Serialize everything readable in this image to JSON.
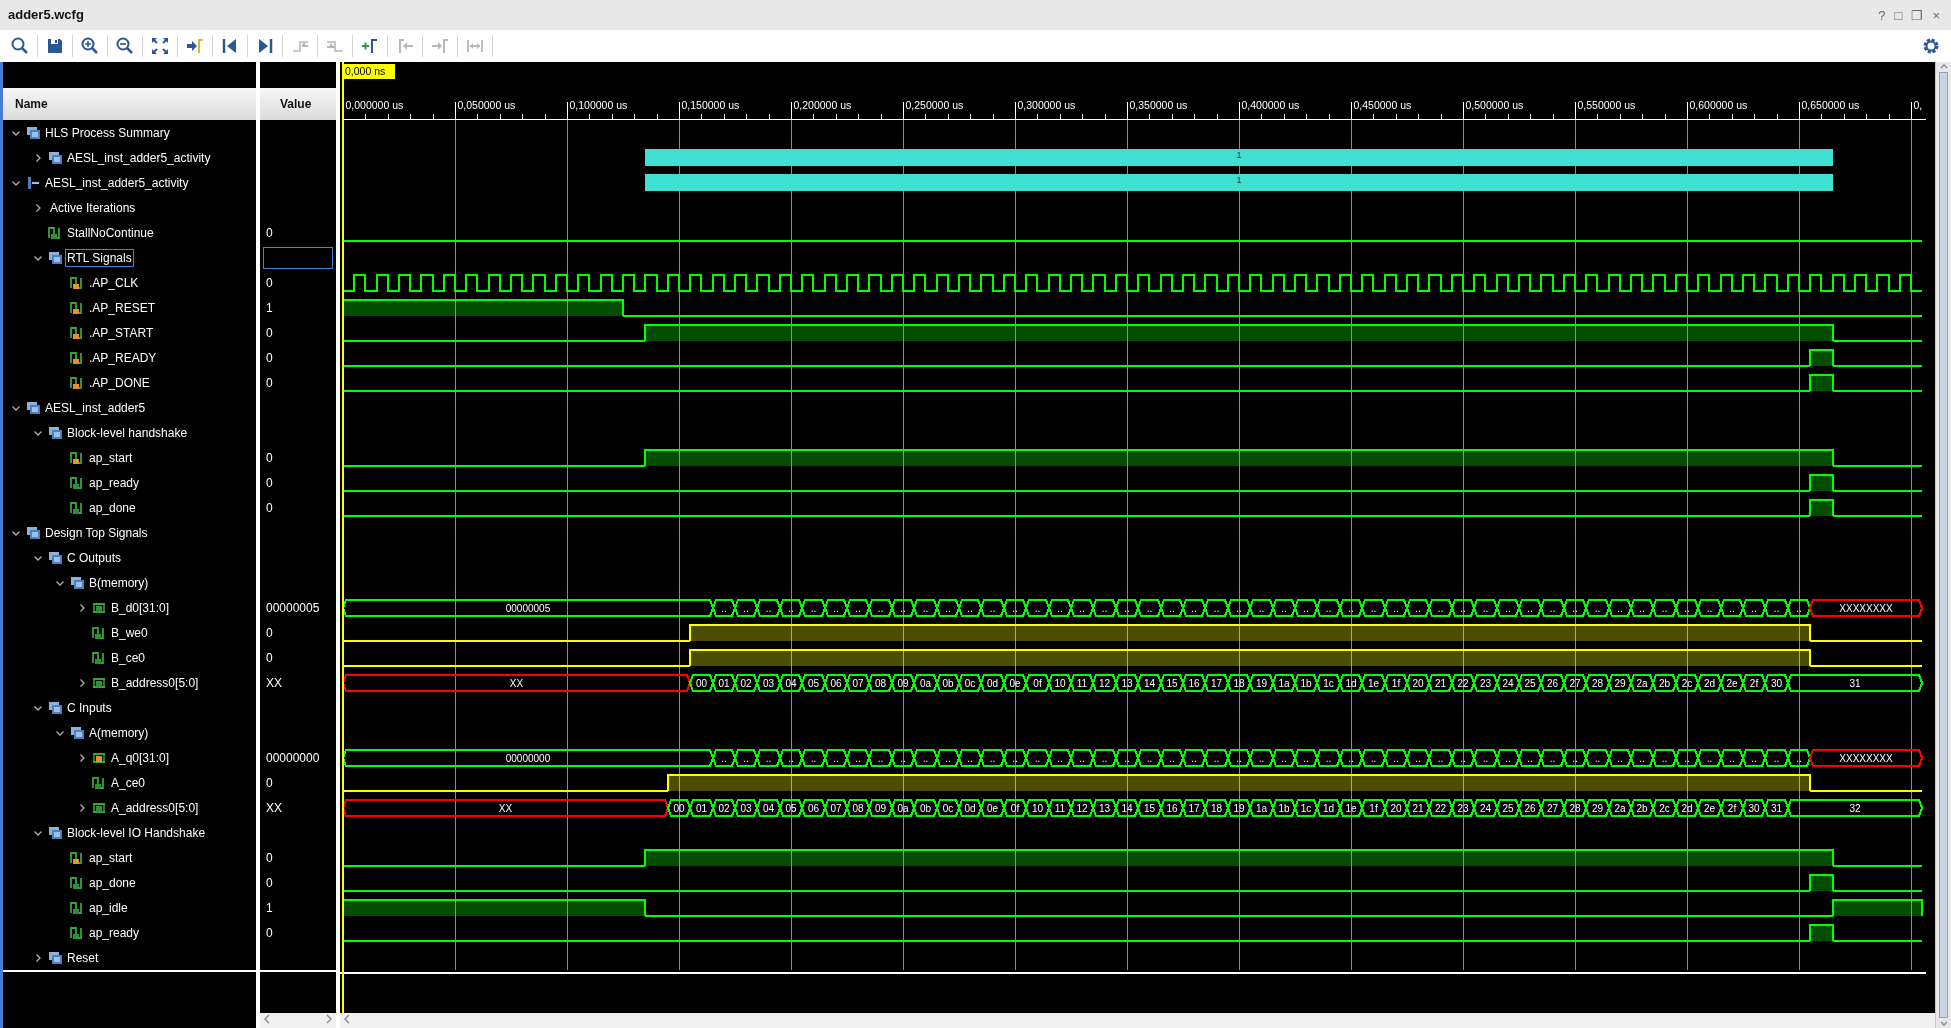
{
  "window": {
    "title": "adder5.wcfg",
    "controls": [
      "?",
      "□",
      "❐",
      "×"
    ]
  },
  "toolbar": [
    {
      "kind": "search",
      "disabled": false
    },
    {
      "kind": "save",
      "disabled": false
    },
    {
      "kind": "zoom-in",
      "disabled": false
    },
    {
      "kind": "zoom-out",
      "disabled": false
    },
    {
      "kind": "fit",
      "disabled": false
    },
    {
      "kind": "go-to-cursor",
      "disabled": false
    },
    {
      "kind": "go-first",
      "disabled": false
    },
    {
      "kind": "go-last",
      "disabled": false
    },
    {
      "kind": "prev-transition",
      "disabled": true
    },
    {
      "kind": "next-transition",
      "disabled": true
    },
    {
      "kind": "add-marker",
      "disabled": false
    },
    {
      "kind": "prev-marker",
      "disabled": true
    },
    {
      "kind": "next-marker",
      "disabled": true
    },
    {
      "kind": "swap",
      "disabled": true
    },
    {
      "kind": "settings",
      "disabled": false
    }
  ],
  "columns": [
    "Name",
    "Value"
  ],
  "waveform": {
    "cursor": "0,000 ns",
    "ruler": [
      "0,000000 us",
      "0,050000 us",
      "0,100000 us",
      "0,150000 us",
      "0,200000 us",
      "0,250000 us",
      "0,300000 us",
      "0,350000 us",
      "0,400000 us",
      "0,450000 us",
      "0,500000 us",
      "0,550000 us",
      "0,600000 us",
      "0,650000 us",
      "0,"
    ]
  },
  "tree": [
    {
      "label": "HLS Process Summary",
      "kind": "group",
      "expanded": true,
      "selected": false,
      "children": [
        {
          "label": "AESL_inst_adder5_activity",
          "kind": "group",
          "expanded": false,
          "selected": false,
          "wave": {
            "kind": "bar",
            "color": "#40e0d0",
            "label": "1"
          }
        }
      ]
    },
    {
      "label": "AESL_inst_adder5_activity",
      "kind": "activity",
      "expanded": true,
      "selected": false,
      "wave": {
        "kind": "bar",
        "color": "#40e0d0",
        "label": "1"
      },
      "children": [
        {
          "label": "Active Iterations",
          "expanded": false,
          "selected": false
        },
        {
          "label": "StallNoContinue",
          "kind": "bit-out",
          "value": "0",
          "selected": false,
          "wave": {
            "kind": "bit",
            "color": "#00ff00",
            "phases": [
              {
                "high": false
              }
            ]
          }
        },
        {
          "label": "RTL Signals",
          "kind": "group",
          "expanded": true,
          "selected": true,
          "children": [
            {
              "label": ".AP_CLK",
              "kind": "bit-in",
              "value": "0",
              "selected": false,
              "wave": {
                "kind": "clock",
                "color": "#00ff00"
              }
            },
            {
              "label": ".AP_RESET",
              "kind": "bit-in",
              "value": "1",
              "selected": false,
              "wave": {
                "kind": "bit",
                "color": "#00ff00",
                "phases": [
                  {
                    "high": true
                  },
                  {
                    "high": false
                  }
                ]
              }
            },
            {
              "label": ".AP_START",
              "kind": "bit-in",
              "value": "0",
              "selected": false,
              "wave": {
                "kind": "bit",
                "color": "#00ff00",
                "phases": [
                  {
                    "high": false
                  },
                  {
                    "high": true
                  },
                  {
                    "high": false
                  }
                ]
              }
            },
            {
              "label": ".AP_READY",
              "kind": "bit-in",
              "value": "0",
              "selected": false,
              "wave": {
                "kind": "bit",
                "color": "#00ff00",
                "phases": [
                  {
                    "high": false
                  },
                  {
                    "high": true
                  },
                  {
                    "high": false
                  }
                ]
              }
            },
            {
              "label": ".AP_DONE",
              "kind": "bit-in",
              "value": "0",
              "selected": false,
              "wave": {
                "kind": "bit",
                "color": "#00ff00",
                "phases": [
                  {
                    "high": false
                  },
                  {
                    "high": true
                  },
                  {
                    "high": false
                  }
                ]
              }
            }
          ]
        }
      ]
    },
    {
      "label": "AESL_inst_adder5",
      "kind": "group",
      "expanded": true,
      "selected": false,
      "children": [
        {
          "label": "Block-level handshake",
          "kind": "group",
          "expanded": true,
          "selected": false,
          "children": [
            {
              "label": "ap_start",
              "kind": "bit-in",
              "value": "0",
              "selected": false,
              "wave": {
                "kind": "bit",
                "color": "#00ff00",
                "phases": [
                  {
                    "high": false
                  },
                  {
                    "high": true
                  },
                  {
                    "high": false
                  }
                ]
              }
            },
            {
              "label": "ap_ready",
              "kind": "bit-out",
              "value": "0",
              "selected": false,
              "wave": {
                "kind": "bit",
                "color": "#00ff00",
                "phases": [
                  {
                    "high": false
                  },
                  {
                    "high": true
                  },
                  {
                    "high": false
                  }
                ]
              }
            },
            {
              "label": "ap_done",
              "kind": "bit-out",
              "value": "0",
              "selected": false,
              "wave": {
                "kind": "bit",
                "color": "#00ff00",
                "phases": [
                  {
                    "high": false
                  },
                  {
                    "high": true
                  },
                  {
                    "high": false
                  }
                ]
              }
            }
          ]
        }
      ]
    },
    {
      "label": "Design Top Signals",
      "kind": "group",
      "expanded": true,
      "selected": false,
      "children": [
        {
          "label": "C Outputs",
          "kind": "group",
          "expanded": true,
          "selected": false,
          "children": [
            {
              "label": "B(memory)",
              "kind": "group",
              "expanded": true,
              "selected": false,
              "children": [
                {
                  "label": "B_d0[31:0]",
                  "kind": "bus-out",
                  "expanded": false,
                  "value": "00000005",
                  "selected": false,
                  "wave": {
                    "kind": "bus",
                    "color": "#00ff00",
                    "segments": [
                      {
                        "unknown": false,
                        "labels": [
                          "00000005"
                        ]
                      },
                      {
                        "unknown": false,
                        "labels": [
                          "..",
                          "..",
                          "..",
                          "..",
                          "..",
                          "..",
                          "..",
                          "..",
                          "..",
                          "..",
                          "..",
                          "..",
                          "..",
                          "..",
                          "..",
                          "..",
                          "..",
                          "..",
                          "..",
                          "..",
                          "..",
                          "..",
                          "..",
                          "..",
                          "..",
                          "..",
                          "..",
                          "..",
                          "..",
                          "..",
                          "..",
                          "..",
                          "..",
                          "..",
                          "..",
                          "..",
                          "..",
                          "..",
                          "..",
                          "..",
                          "..",
                          "..",
                          "..",
                          "..",
                          "..",
                          "..",
                          "..",
                          "..",
                          ".."
                        ]
                      },
                      {
                        "unknown": true,
                        "labels": [
                          "XXXXXXXX"
                        ]
                      }
                    ]
                  }
                },
                {
                  "label": "B_we0",
                  "kind": "bit-out",
                  "value": "0",
                  "selected": false,
                  "wave": {
                    "kind": "bit",
                    "color": "#ffff00",
                    "phases": [
                      {
                        "high": false
                      },
                      {
                        "high": true
                      },
                      {
                        "high": false
                      }
                    ]
                  }
                },
                {
                  "label": "B_ce0",
                  "kind": "bit-out",
                  "value": "0",
                  "selected": false,
                  "wave": {
                    "kind": "bit",
                    "color": "#ffff00",
                    "phases": [
                      {
                        "high": false
                      },
                      {
                        "high": true
                      },
                      {
                        "high": false
                      }
                    ]
                  }
                },
                {
                  "label": "B_address0[5:0]",
                  "kind": "bus-out",
                  "expanded": false,
                  "value": "XX",
                  "selected": false,
                  "wave": {
                    "kind": "bus",
                    "color": "#00ff00",
                    "segments": [
                      {
                        "unknown": true,
                        "labels": [
                          "XX"
                        ]
                      },
                      {
                        "unknown": false,
                        "labels": [
                          "00",
                          "01",
                          "02",
                          "03",
                          "04",
                          "05",
                          "06",
                          "07",
                          "08",
                          "09",
                          "0a",
                          "0b",
                          "0c",
                          "0d",
                          "0e",
                          "0f",
                          "10",
                          "11",
                          "12",
                          "13",
                          "14",
                          "15",
                          "16",
                          "17",
                          "18",
                          "19",
                          "1a",
                          "1b",
                          "1c",
                          "1d",
                          "1e",
                          "1f",
                          "20",
                          "21",
                          "22",
                          "23",
                          "24",
                          "25",
                          "26",
                          "27",
                          "28",
                          "29",
                          "2a",
                          "2b",
                          "2c",
                          "2d",
                          "2e",
                          "2f",
                          "30"
                        ]
                      },
                      {
                        "unknown": false,
                        "labels": [
                          "31"
                        ]
                      }
                    ]
                  }
                }
              ]
            }
          ]
        },
        {
          "label": "C Inputs",
          "kind": "group",
          "expanded": true,
          "selected": false,
          "children": [
            {
              "label": "A(memory)",
              "kind": "group",
              "expanded": true,
              "selected": false,
              "children": [
                {
                  "label": "A_q0[31:0]",
                  "kind": "bus-in",
                  "expanded": false,
                  "value": "00000000",
                  "selected": false,
                  "wave": {
                    "kind": "bus",
                    "color": "#00ff00",
                    "segments": [
                      {
                        "unknown": false,
                        "labels": [
                          "00000000"
                        ]
                      },
                      {
                        "unknown": false,
                        "labels": [
                          "..",
                          "..",
                          "..",
                          "..",
                          "..",
                          "..",
                          "..",
                          "..",
                          "..",
                          "..",
                          "..",
                          "..",
                          "..",
                          "..",
                          "..",
                          "..",
                          "..",
                          "..",
                          "..",
                          "..",
                          "..",
                          "..",
                          "..",
                          "..",
                          "..",
                          "..",
                          "..",
                          "..",
                          "..",
                          "..",
                          "..",
                          "..",
                          "..",
                          "..",
                          "..",
                          "..",
                          "..",
                          "..",
                          "..",
                          "..",
                          "..",
                          "..",
                          "..",
                          "..",
                          "..",
                          "..",
                          "..",
                          "..",
                          ".."
                        ]
                      },
                      {
                        "unknown": true,
                        "labels": [
                          "XXXXXXXX"
                        ]
                      }
                    ]
                  }
                },
                {
                  "label": "A_ce0",
                  "kind": "bit-out",
                  "value": "0",
                  "selected": false,
                  "wave": {
                    "kind": "bit",
                    "color": "#ffff00",
                    "phases": [
                      {
                        "high": false
                      },
                      {
                        "high": true
                      },
                      {
                        "high": false
                      }
                    ]
                  }
                },
                {
                  "label": "A_address0[5:0]",
                  "kind": "bus-out",
                  "expanded": false,
                  "value": "XX",
                  "selected": false,
                  "wave": {
                    "kind": "bus",
                    "color": "#00ff00",
                    "segments": [
                      {
                        "unknown": true,
                        "labels": [
                          "XX"
                        ]
                      },
                      {
                        "unknown": false,
                        "labels": [
                          "00",
                          "01",
                          "02",
                          "03",
                          "04",
                          "05",
                          "06",
                          "07",
                          "08",
                          "09",
                          "0a",
                          "0b",
                          "0c",
                          "0d",
                          "0e",
                          "0f",
                          "10",
                          "11",
                          "12",
                          "13",
                          "14",
                          "15",
                          "16",
                          "17",
                          "18",
                          "19",
                          "1a",
                          "1b",
                          "1c",
                          "1d",
                          "1e",
                          "1f",
                          "20",
                          "21",
                          "22",
                          "23",
                          "24",
                          "25",
                          "26",
                          "27",
                          "28",
                          "29",
                          "2a",
                          "2b",
                          "2c",
                          "2d",
                          "2e",
                          "2f",
                          "30",
                          "31"
                        ]
                      },
                      {
                        "unknown": false,
                        "labels": [
                          "32"
                        ]
                      }
                    ]
                  }
                }
              ]
            }
          ]
        },
        {
          "label": "Block-level IO Handshake",
          "kind": "group",
          "expanded": true,
          "selected": false,
          "children": [
            {
              "label": "ap_start",
              "kind": "bit-in",
              "value": "0",
              "selected": false,
              "wave": {
                "kind": "bit",
                "color": "#00ff00",
                "phases": [
                  {
                    "high": false
                  },
                  {
                    "high": true
                  },
                  {
                    "high": false
                  }
                ]
              }
            },
            {
              "label": "ap_done",
              "kind": "bit-out",
              "value": "0",
              "selected": false,
              "wave": {
                "kind": "bit",
                "color": "#00ff00",
                "phases": [
                  {
                    "high": false
                  },
                  {
                    "high": true
                  },
                  {
                    "high": false
                  }
                ]
              }
            },
            {
              "label": "ap_idle",
              "kind": "bit-out",
              "value": "1",
              "selected": false,
              "wave": {
                "kind": "bit",
                "color": "#00ff00",
                "phases": [
                  {
                    "high": true
                  },
                  {
                    "high": false
                  },
                  {
                    "high": true
                  }
                ]
              }
            },
            {
              "label": "ap_ready",
              "kind": "bit-out",
              "value": "0",
              "selected": false,
              "wave": {
                "kind": "bit",
                "color": "#00ff00",
                "phases": [
                  {
                    "high": false
                  },
                  {
                    "high": true
                  },
                  {
                    "high": false
                  }
                ]
              }
            }
          ]
        },
        {
          "label": "Reset",
          "kind": "group",
          "expanded": false,
          "selected": false
        }
      ]
    }
  ]
}
